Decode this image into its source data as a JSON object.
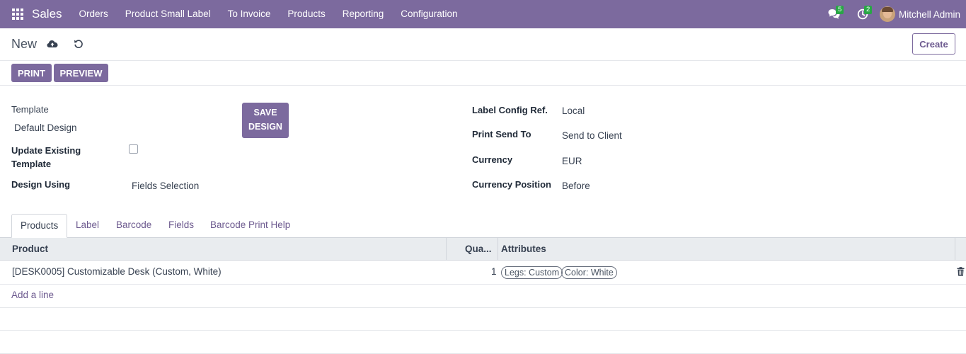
{
  "navbar": {
    "brand": "Sales",
    "menu": [
      "Orders",
      "Product Small Label",
      "To Invoice",
      "Products",
      "Reporting",
      "Configuration"
    ],
    "messages_badge": "5",
    "activities_badge": "2",
    "user_name": "Mitchell Admin",
    "color": "#7c6a9e"
  },
  "control": {
    "breadcrumb": "New",
    "create_label": "Create"
  },
  "buttons": {
    "print": "PRINT",
    "preview": "PREVIEW",
    "save_design": "SAVE DESIGN"
  },
  "form": {
    "template_label": "Template",
    "template_value": "Default Design",
    "update_existing_label": "Update Existing Template",
    "update_existing_checked": false,
    "design_using_label": "Design Using",
    "design_using_value": "Fields Selection",
    "label_config_ref_label": "Label Config Ref.",
    "label_config_ref_value": "Local",
    "print_send_to_label": "Print Send To",
    "print_send_to_value": "Send to Client",
    "currency_label": "Currency",
    "currency_value": "EUR",
    "currency_position_label": "Currency Position",
    "currency_position_value": "Before"
  },
  "tabs": [
    "Products",
    "Label",
    "Barcode",
    "Fields",
    "Barcode Print Help"
  ],
  "active_tab": "Products",
  "table": {
    "headers": {
      "product": "Product",
      "quantity": "Qua...",
      "attributes": "Attributes"
    },
    "rows": [
      {
        "product": "[DESK0005] Customizable Desk (Custom, White)",
        "quantity": "1",
        "attributes": [
          "Legs: Custom",
          "Color: White"
        ]
      }
    ],
    "add_line": "Add a line"
  }
}
